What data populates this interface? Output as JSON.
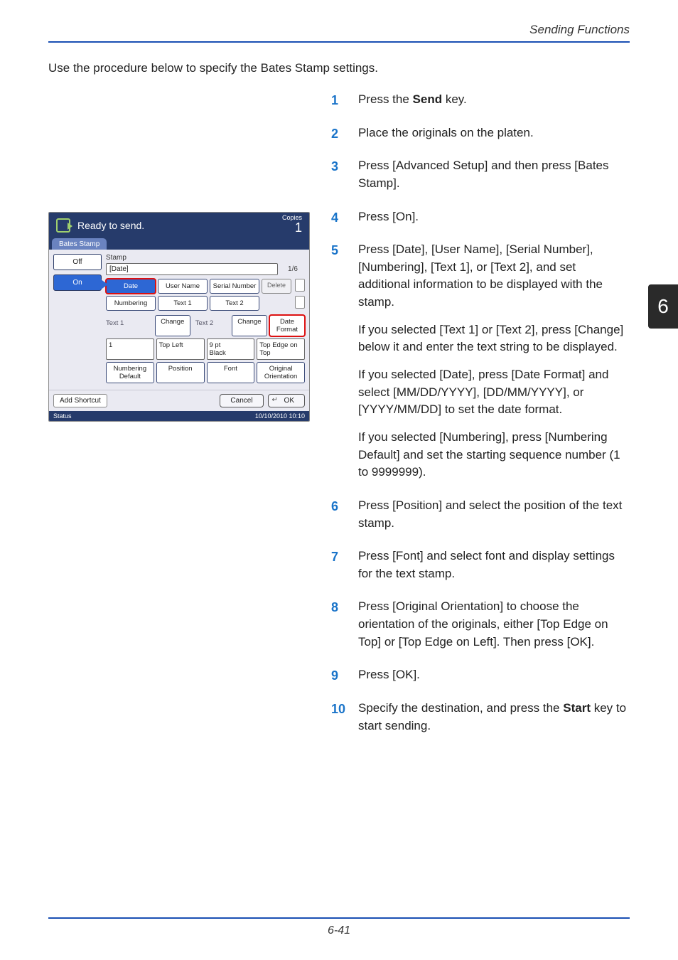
{
  "header": {
    "running": "Sending Functions"
  },
  "side_tab": "6",
  "intro": "Use the procedure below to specify the Bates Stamp settings.",
  "steps": {
    "s1": {
      "t1": "Press the ",
      "b": "Send",
      "t2": " key."
    },
    "s2": "Place the originals on the platen.",
    "s3": "Press [Advanced Setup] and then press [Bates Stamp].",
    "s4": "Press [On].",
    "s5main": "Press [Date], [User Name], [Serial Number], [Numbering], [Text 1], or [Text 2], and set additional information to be displayed with the stamp.",
    "s5a": "If you selected [Text 1] or [Text 2], press [Change] below it and enter the text string to be displayed.",
    "s5b": "If you selected [Date], press [Date Format] and select [MM/DD/YYYY], [DD/MM/YYYY], or [YYYY/MM/DD] to set the date format.",
    "s5c": "If you selected [Numbering], press [Numbering Default] and set the starting sequence number (1 to 9999999).",
    "s6": "Press [Position] and select the position of the text stamp.",
    "s7": "Press [Font] and select font and display settings for the text stamp.",
    "s8": "Press [Original Orientation] to choose the orientation of the originals, either [Top Edge on Top] or [Top Edge on Left]. Then press [OK].",
    "s9": "Press [OK].",
    "s10": {
      "t1": "Specify the destination, and press the ",
      "b": "Start",
      "t2": " key to start sending."
    }
  },
  "footer": {
    "page_num": "6-41"
  },
  "panel": {
    "title": "Ready to send.",
    "copies_label": "Copies",
    "copies_val": "1",
    "tab": "Bates Stamp",
    "off": "Off",
    "on": "On",
    "stamp_label": "Stamp",
    "date_field": "[Date]",
    "pages": "1/6",
    "row1": {
      "a": "Date",
      "b": "User Name",
      "c": "Serial Number"
    },
    "row2": {
      "a": "Numbering",
      "b": "Text 1",
      "c": "Text 2"
    },
    "delete": "Delete",
    "text1_label": "Text 1",
    "text2_label": "Text 2",
    "change": "Change",
    "date_format": "Date Format",
    "num_val": "1",
    "pos_val": "Top Left",
    "font_val1": "9 pt",
    "font_val2": "Black",
    "orient_val": "Top Edge on Top",
    "num_default": "Numbering Default",
    "position": "Position",
    "font": "Font",
    "orientation": "Original Orientation",
    "add_shortcut": "Add Shortcut",
    "cancel": "Cancel",
    "ok": "OK",
    "status": "Status",
    "timestamp": "10/10/2010  10:10"
  }
}
